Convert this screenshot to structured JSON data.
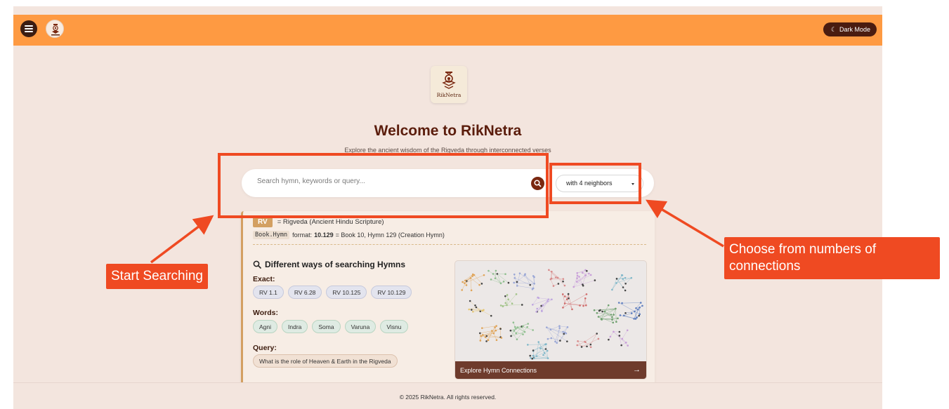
{
  "header": {
    "dark_mode_label": "Dark Mode",
    "menu_icon": "menu-icon",
    "logo_icon": "riknetra-logo-icon"
  },
  "hero": {
    "logo_name": "RikNetra",
    "title": "Welcome to RikNetra",
    "subtitle": "Explore the ancient wisdom of the Rigveda through interconnected verses"
  },
  "search": {
    "placeholder": "Search hymn, keywords or query...",
    "neighbors_value": "with 4 neighbors"
  },
  "info": {
    "rv_tag": "RV",
    "rv_desc": "= Rigveda (Ancient Hindu Scripture)",
    "format_code": "Book.Hymn",
    "format_text": "format:",
    "format_example": "10.129",
    "format_desc": "= Book 10, Hymn 129 (Creation Hymn)",
    "ways_title": "Different ways of searching Hymns",
    "exact_label": "Exact:",
    "exact_items": [
      "RV 1.1",
      "RV 6.28",
      "RV 10.125",
      "RV 10.129"
    ],
    "words_label": "Words:",
    "words_items": [
      "Agni",
      "Indra",
      "Soma",
      "Varuna",
      "Visnu"
    ],
    "query_label": "Query:",
    "query_items": [
      "What is the role of Heaven & Earth in the Rigveda"
    ],
    "explore_label": "Explore Hymn Connections"
  },
  "footer": {
    "text": "© 2025 RikNetra. All rights reserved."
  },
  "annotations": {
    "start_searching": "Start Searching",
    "choose_line1": "Choose from numbers of",
    "choose_line2": "connections"
  },
  "colors": {
    "topbar": "#fe9a42",
    "accent": "#ef4a22",
    "brand_dark": "#5b1d0c"
  }
}
